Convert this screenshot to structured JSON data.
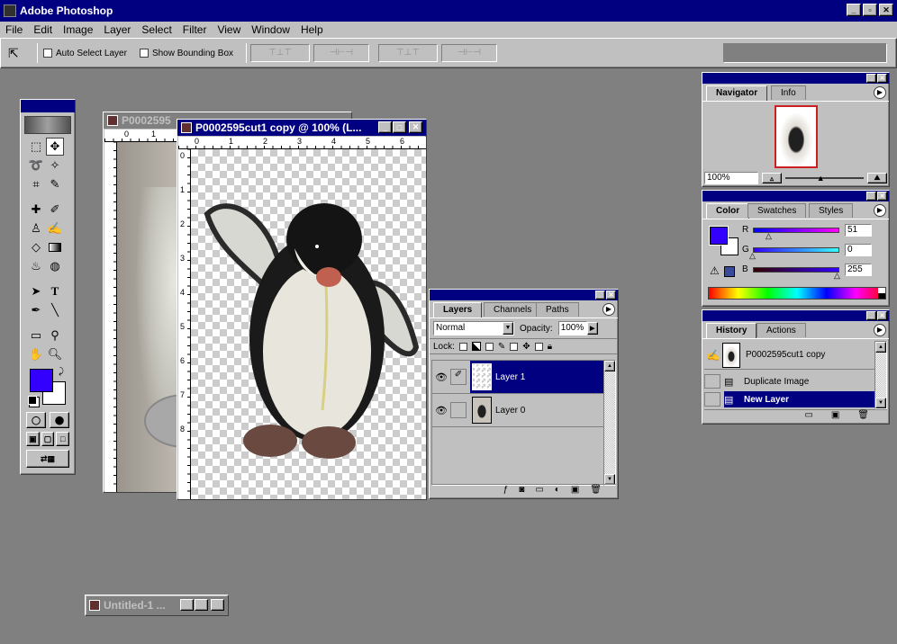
{
  "app": {
    "title": "Adobe Photoshop"
  },
  "menu": [
    "File",
    "Edit",
    "Image",
    "Layer",
    "Select",
    "Filter",
    "View",
    "Window",
    "Help"
  ],
  "options_bar": {
    "auto_select_label": "Auto Select Layer",
    "show_bbox_label": "Show Bounding Box"
  },
  "doc_back": {
    "title": "P0002595"
  },
  "doc_front": {
    "title": "P0002595cut1 copy @ 100% (L..."
  },
  "ruler_h_labels": [
    "0",
    "1",
    "2",
    "3",
    "4",
    "5",
    "6"
  ],
  "ruler_v_labels": [
    "0",
    "1",
    "2",
    "3",
    "4",
    "5",
    "6",
    "7",
    "8"
  ],
  "ruler_back_labels": [
    "0",
    "1"
  ],
  "navigator": {
    "tabs": [
      "Navigator",
      "Info"
    ],
    "zoom": "100%"
  },
  "color": {
    "tabs": [
      "Color",
      "Swatches",
      "Styles"
    ],
    "r_label": "R",
    "g_label": "G",
    "b_label": "B",
    "r": "51",
    "g": "0",
    "b": "255",
    "foreground": "#3300ff"
  },
  "history": {
    "tabs": [
      "History",
      "Actions"
    ],
    "snapshot": "P0002595cut1 copy",
    "items": [
      "Duplicate Image",
      "New Layer"
    ]
  },
  "layers": {
    "tabs": [
      "Layers",
      "Channels",
      "Paths"
    ],
    "blend_mode": "Normal",
    "opacity_label": "Opacity:",
    "opacity": "100%",
    "lock_label": "Lock:",
    "items": [
      "Layer 1",
      "Layer 0"
    ]
  },
  "minimized_doc": {
    "title": "Untitled-1 ..."
  }
}
